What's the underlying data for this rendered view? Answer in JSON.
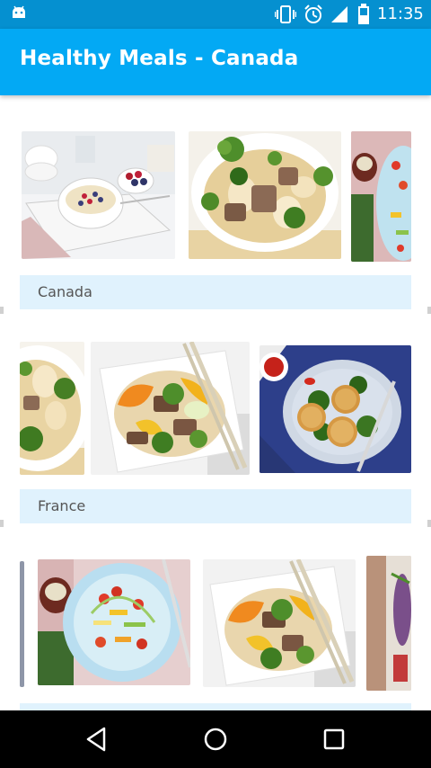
{
  "status_bar": {
    "time": "11:35",
    "icons": [
      "android-icon",
      "vibrate-icon",
      "alarm-icon",
      "signal-icon",
      "battery-icon"
    ]
  },
  "app_bar": {
    "title": "Healthy Meals  - Canada"
  },
  "sections": [
    {
      "label": "Canada"
    },
    {
      "label": "France"
    }
  ],
  "nav_bar": {
    "icons": [
      "back-icon",
      "home-icon",
      "recents-icon"
    ]
  },
  "colors": {
    "status_bar": "#0590d0",
    "app_bar": "#03a9f4",
    "category_bg": "#e0f2fd"
  }
}
